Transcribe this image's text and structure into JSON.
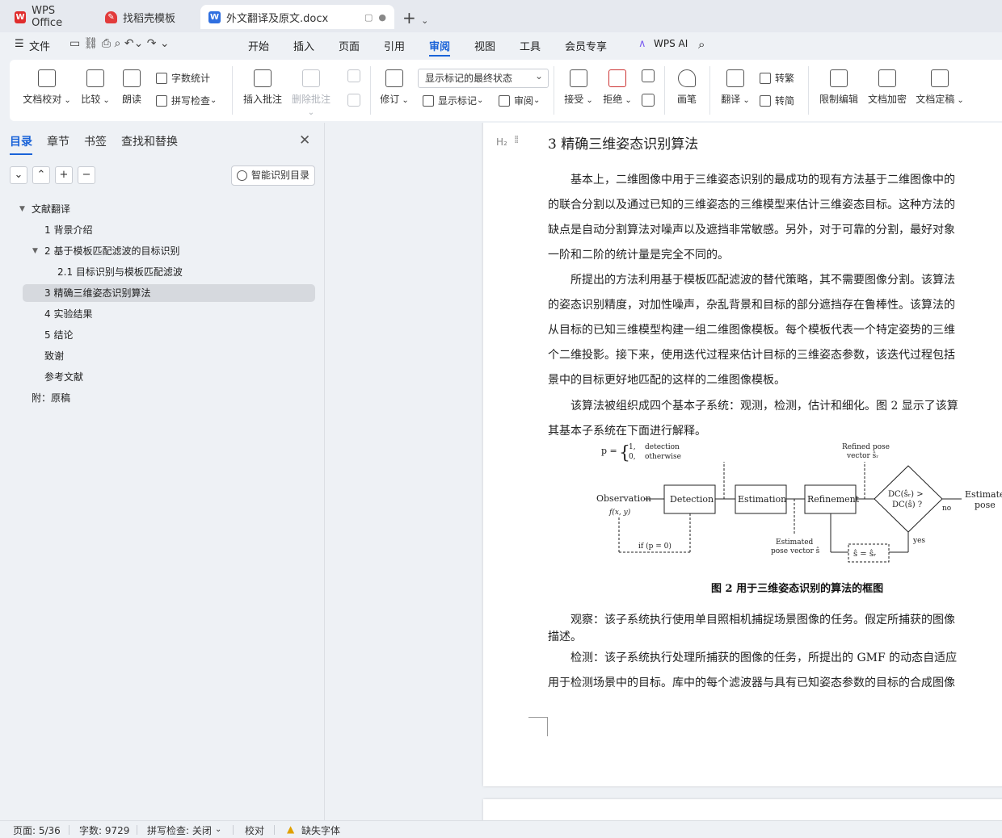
{
  "tabs": [
    {
      "label": "WPS Office",
      "icon": "wps-logo-icon"
    },
    {
      "label": "找稻壳模板",
      "icon": "docer-logo-icon"
    },
    {
      "label": "外文翻译及原文.docx",
      "icon": "word-doc-icon"
    }
  ],
  "menu": {
    "file": "文件",
    "items": [
      "开始",
      "插入",
      "页面",
      "引用",
      "审阅",
      "视图",
      "工具",
      "会员专享"
    ],
    "active": "审阅",
    "ai": "WPS AI"
  },
  "ribbon": {
    "doc_check": "文档校对",
    "compare": "比较",
    "read_aloud": "朗读",
    "word_count": "字数统计",
    "spell_check": "拼写检查",
    "insert_comment": "插入批注",
    "delete_comment": "删除批注",
    "revise": "修订",
    "markup_state": "显示标记的最终状态",
    "show_markup": "显示标记",
    "review": "审阅",
    "accept": "接受",
    "reject": "拒绝",
    "pen": "画笔",
    "translate": "翻译",
    "to_traditional": "转繁",
    "to_simplified": "转简",
    "restrict_edit": "限制编辑",
    "encrypt": "文档加密",
    "finalize": "文档定稿"
  },
  "panel": {
    "tabs": [
      "目录",
      "章节",
      "书签",
      "查找和替换"
    ],
    "smart_toc": "智能识别目录",
    "toc": [
      {
        "label": "文献翻译",
        "level": 0,
        "caret": true
      },
      {
        "label": "1  背景介绍",
        "level": 1
      },
      {
        "label": "2  基于模板匹配滤波的目标识别",
        "level": 1,
        "caret": true
      },
      {
        "label": "2.1 目标识别与模板匹配滤波",
        "level": 2
      },
      {
        "label": "3 精确三维姿态识别算法",
        "level": 1,
        "selected": true
      },
      {
        "label": "4  实验结果",
        "level": 1
      },
      {
        "label": "5  结论",
        "level": 1
      },
      {
        "label": "致谢",
        "level": 1
      },
      {
        "label": "参考文献",
        "level": 1
      },
      {
        "label": "附：原稿",
        "level": 0
      }
    ]
  },
  "document": {
    "heading": "3 精确三维姿态识别算法",
    "lines": [
      "基本上，二维图像中用于三维姿态识别的最成功的现有方法基于二维图像中的",
      "的联合分割以及通过已知的三维姿态的三维模型来估计三维姿态目标。这种方法的",
      "缺点是自动分割算法对噪声以及遮挡非常敏感。另外，对于可靠的分割，最好对象",
      "一阶和二阶的统计量是完全不同的。",
      "所提出的方法利用基于模板匹配滤波的替代策略，其不需要图像分割。该算法",
      "的姿态识别精度，对加性噪声，杂乱背景和目标的部分遮挡存在鲁棒性。该算法的",
      "从目标的已知三维模型构建一组二维图像模板。每个模板代表一个特定姿势的三维",
      "个二维投影。接下来，使用迭代过程来估计目标的三维姿态参数，该迭代过程包括",
      "景中的目标更好地匹配的这样的二维图像模板。",
      "该算法被组织成四个基本子系统：观测，检测，估计和细化。图 2 显示了该算",
      "其基本子系统在下面进行解释。",
      "观察：该子系统执行使用单目照相机捕捉场景图像的任务。假定所捕获的图像",
      "描述。",
      "检测：该子系统执行处理所捕获的图像的任务，所提出的 GMF 的动态自适应",
      "用于检测场景中的目标。库中的每个滤波器与具有已知姿态参数的目标的合成图像"
    ],
    "figure": {
      "p_eq": "p =",
      "p_one": "1,",
      "p_zero": "0,",
      "p_detection": "detection",
      "p_otherwise": "otherwise",
      "refined_top": "Refined pose",
      "refined_bottom": "vector ŝᵣ",
      "observation": "Observation",
      "fxy": "f(x, y)",
      "detection": "Detection",
      "estimation": "Estimation",
      "refinement": "Refinement",
      "dc_top": "DC(ŝᵣ) >",
      "dc_bottom": "DC(ŝ) ?",
      "no": "no",
      "yes": "yes",
      "estimate_top": "Estimate",
      "estimate_bottom": "pose",
      "if_p": "if (p = 0)",
      "est_pose_top": "Estimated",
      "est_pose_bottom": "pose vector ŝ",
      "assign": "ŝ = ŝᵣ"
    },
    "caption": "图 2  用于三维姿态识别的算法的框图"
  },
  "status": {
    "page": "页面: 5/36",
    "words": "字数: 9729",
    "spell": "拼写检查: 关闭",
    "proof": "校对",
    "missing_font": "缺失字体"
  }
}
